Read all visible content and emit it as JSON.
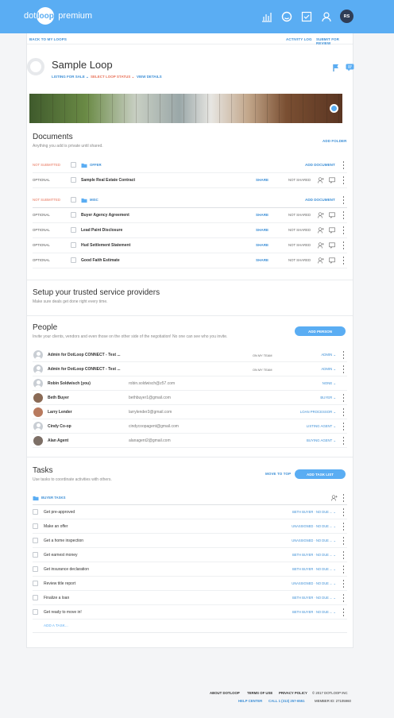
{
  "brand": {
    "prefix": "dot",
    "circle": "loop",
    "suffix": "premium"
  },
  "header": {
    "nav_icons": [
      "bar-chart-icon",
      "loop-icon",
      "checkbox-icon",
      "person-icon",
      "document-icon"
    ],
    "user_initials": "RS"
  },
  "links": {
    "back": "BACK TO MY LOOPS",
    "activity": "ACTIVITY LOG",
    "submit": "SUBMIT FOR REVIEW"
  },
  "loop": {
    "title": "Sample Loop",
    "status": "LISTING FOR SALE",
    "select_status": "SELECT LOOP STATUS",
    "view_details": "VIEW DETAILS"
  },
  "documents": {
    "title": "Documents",
    "subtitle": "Anything you add is private until shared.",
    "add_folder": "ADD FOLDER",
    "folders": [
      {
        "status": "NOT SUBMITTED",
        "name": "OFFER",
        "add_doc": "ADD DOCUMENT",
        "docs": [
          {
            "tag": "OPTIONAL",
            "name": "Sample Real Estate Contract",
            "share": "SHARE",
            "shared": "NOT SHARED"
          }
        ]
      },
      {
        "status": "NOT SUBMITTED",
        "name": "MISC",
        "add_doc": "ADD DOCUMENT",
        "docs": [
          {
            "tag": "OPTIONAL",
            "name": "Buyer Agency Agreement",
            "share": "SHARE",
            "shared": "NOT SHARED"
          },
          {
            "tag": "OPTIONAL",
            "name": "Lead Paint Disclosure",
            "share": "SHARE",
            "shared": "NOT SHARED"
          },
          {
            "tag": "OPTIONAL",
            "name": "Hud Settlement Statement",
            "share": "SHARE",
            "shared": "NOT SHARED"
          },
          {
            "tag": "OPTIONAL",
            "name": "Good Faith Estimate",
            "share": "SHARE",
            "shared": "NOT SHARED"
          }
        ]
      }
    ]
  },
  "providers": {
    "title": "Setup your trusted service providers",
    "subtitle": "Make sure deals get done right every time."
  },
  "people": {
    "title": "People",
    "subtitle": "Invite your clients, vendors and even those on the other side of the negotiation! No one can see who you invite.",
    "add_button": "ADD PERSON",
    "rows": [
      {
        "name": "Admin for DotLoop CONNECT - Test ...",
        "email": "",
        "team": "ON MY TEAM",
        "role": "ADMIN ⌄"
      },
      {
        "name": "Admin for DotLoop CONNECT - Test ...",
        "email": "",
        "team": "ON MY TEAM",
        "role": "ADMIN ⌄"
      },
      {
        "name": "Robin Soldwisch (you)",
        "email": "robin.soldwisch@z57.com",
        "team": "",
        "role": "NONE ⌄"
      },
      {
        "name": "Beth Buyer",
        "email": "bethbuyer1@gmail.com",
        "team": "",
        "role": "BUYER ⌄"
      },
      {
        "name": "Larry Lender",
        "email": "larrylender3@gmail.com",
        "team": "",
        "role": "LOAN PROCESSOR ⌄"
      },
      {
        "name": "Cindy Co-op",
        "email": "cindycoopagent@gmail.com",
        "team": "",
        "role": "LISTING AGENT ⌄"
      },
      {
        "name": "Alan Agent",
        "email": "alanagent2@gmail.com",
        "team": "",
        "role": "BUYING AGENT ⌄"
      }
    ]
  },
  "tasks": {
    "title": "Tasks",
    "subtitle": "Use tasks to coordinate activities with others.",
    "move_to_top": "MOVE TO TOP",
    "add_button": "ADD TASK LIST",
    "list_name": "BUYER TASKS",
    "items": [
      {
        "name": "Get pre-approved",
        "assign": "BETH BUYER · NO DUE ... ⌄"
      },
      {
        "name": "Make an offer",
        "assign": "UNASSIGNED · NO DUE ... ⌄"
      },
      {
        "name": "Get a home inspection",
        "assign": "UNASSIGNED · NO DUE ... ⌄"
      },
      {
        "name": "Get earnest money",
        "assign": "BETH BUYER · NO DUE ... ⌄"
      },
      {
        "name": "Get insurance declaration",
        "assign": "BETH BUYER · NO DUE ... ⌄"
      },
      {
        "name": "Review title report",
        "assign": "UNASSIGNED · NO DUE ... ⌄"
      },
      {
        "name": "Finalize a loan",
        "assign": "BETH BUYER · NO DUE ... ⌄"
      },
      {
        "name": "Get ready to move in!",
        "assign": "BETH BUYER · NO DUE ... ⌄"
      }
    ],
    "add_task": "ADD A TASK..."
  },
  "footer": {
    "about": "ABOUT DOTLOOP",
    "terms": "TERMS OF USE",
    "privacy": "PRIVACY POLICY",
    "copyright": "© 2017 DOTLOOP INC",
    "help": "HELP CENTER",
    "call": "CALL 1 (313) 257-6551",
    "member": "MEMBER ID: 27105960"
  },
  "colors": {
    "brand_blue": "#5aadf3",
    "link_blue": "#3d8fd6",
    "warn": "#e8735a"
  }
}
